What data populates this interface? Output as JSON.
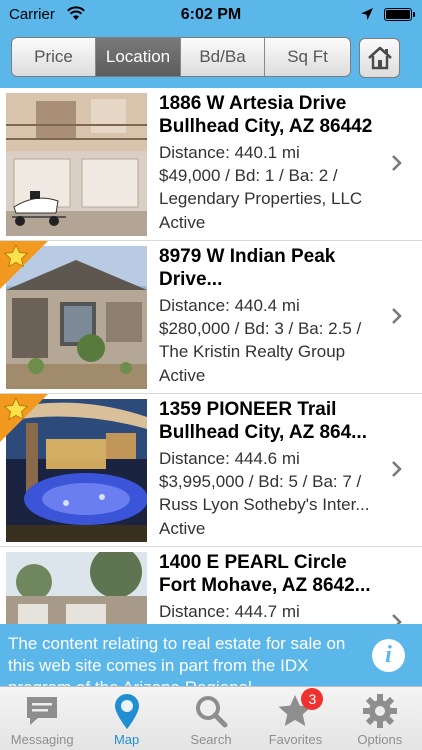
{
  "status_bar": {
    "carrier": "Carrier",
    "time": "6:02 PM"
  },
  "sort_options": [
    "Price",
    "Location",
    "Bd/Ba",
    "Sq Ft"
  ],
  "sort_active": "Location",
  "listings": [
    {
      "address_line1": "1886 W Artesia Drive",
      "address_line2": "Bullhead City, AZ 86442",
      "distance": "Distance: 440.1 mi",
      "price_beds_baths": "$49,000 / Bd: 1 / Ba: 2 /",
      "agency": "Legendary Properties, LLC",
      "status": "Active",
      "featured": false
    },
    {
      "address_line1": "8979 W Indian Peak",
      "address_line2": "Drive...",
      "distance": "Distance: 440.4 mi",
      "price_beds_baths": "$280,000 / Bd: 3 / Ba: 2.5 /",
      "agency": "The Kristin Realty Group",
      "status": "Active",
      "featured": true
    },
    {
      "address_line1": "1359 PIONEER Trail",
      "address_line2": "Bullhead City, AZ 864...",
      "distance": "Distance: 444.6 mi",
      "price_beds_baths": "$3,995,000 / Bd: 5 / Ba: 7 /",
      "agency": "Russ Lyon Sotheby's Inter...",
      "status": "Active",
      "featured": true
    },
    {
      "address_line1": "1400 E PEARL Circle",
      "address_line2": "Fort Mohave, AZ 8642...",
      "distance": "Distance: 444.7 mi",
      "price_beds_baths": "",
      "agency": "",
      "status": "",
      "featured": false
    }
  ],
  "disclaimer": {
    "text": "The content relating to real estate for sale on this web site comes in part from the IDX program of the Arizona Regional"
  },
  "tabs": [
    {
      "label": "Messaging",
      "icon": "speech-bubble-icon",
      "active": false
    },
    {
      "label": "Map",
      "icon": "map-pin-icon",
      "active": true
    },
    {
      "label": "Search",
      "icon": "magnifier-icon",
      "active": false
    },
    {
      "label": "Favorites",
      "icon": "star-icon",
      "active": false,
      "badge": "3"
    },
    {
      "label": "Options",
      "icon": "gear-icon",
      "active": false
    }
  ],
  "colors": {
    "header_blue": "#5bb7ea",
    "active_tab_blue": "#1f8fd1",
    "badge_red": "#f0322f",
    "featured_orange": "#f29a1f"
  }
}
